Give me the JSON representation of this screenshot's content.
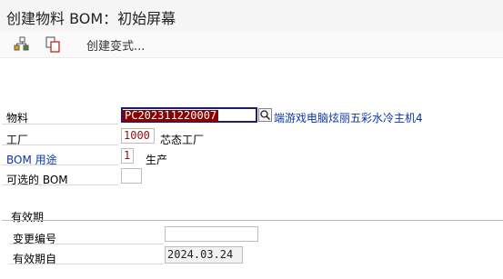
{
  "window": {
    "title": "创建物料 BOM：初始屏幕"
  },
  "toolbar": {
    "variant_label": "创建变式..."
  },
  "form": {
    "material": {
      "label": "物料",
      "value": "PC202311220007",
      "description": "端游戏电脑炫丽五彩水冷主机4"
    },
    "plant": {
      "label": "工厂",
      "value": "1000",
      "description": "芯态工厂"
    },
    "bom_usage": {
      "label": "BOM 用途",
      "value": "1",
      "description": "生产"
    },
    "alt_bom": {
      "label": "可选的 BOM",
      "value": ""
    }
  },
  "validity": {
    "section_title": "有效期",
    "change_number": {
      "label": "变更编号",
      "value": ""
    },
    "valid_from": {
      "label": "有效期自",
      "value": "2024.03.24"
    }
  }
}
